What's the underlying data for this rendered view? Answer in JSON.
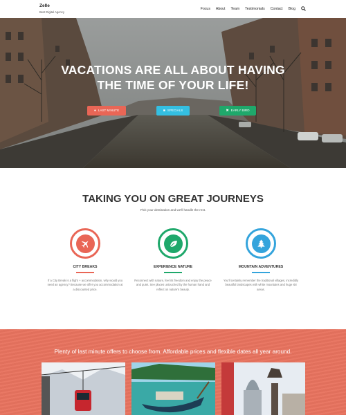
{
  "header": {
    "brand": "Zelle",
    "tagline": "Best Digital Agency",
    "nav": [
      "Focus",
      "About",
      "Team",
      "Testimonials",
      "Contact",
      "Blog"
    ],
    "search_icon": "search-icon"
  },
  "hero": {
    "title_line1": "VACATIONS ARE ALL ABOUT HAVING",
    "title_line2": "THE TIME OF YOUR LIFE!",
    "buttons": [
      {
        "label": "LAST MINUTE",
        "icon": "tag-icon",
        "color": "#e96656"
      },
      {
        "label": "SPECIALS",
        "icon": "gift-icon",
        "color": "#34bfe2"
      },
      {
        "label": "EARLY BIRD",
        "icon": "plane-icon",
        "color": "#1fa86b"
      }
    ]
  },
  "journeys": {
    "title": "TAKING YOU ON GREAT JOURNEYS",
    "subtitle": "Pick your destination and we'll handle the rest.",
    "features": [
      {
        "title": "CITY BREAKS",
        "icon": "plane-icon",
        "color": "#e96656",
        "desc": "If a City Break is a flight + accommodation, why would you need an agency? Because we offer you accommodation at a discounted price."
      },
      {
        "title": "EXPERIENCE NATURE",
        "icon": "leaf-icon",
        "color": "#1fa86b",
        "desc": "Reconnect with nature, feel its freedom and enjoy the peace and quiet. See places untouched by the human hand and reflect on nature's beauty."
      },
      {
        "title": "MOUNTAIN ADVENTURES",
        "icon": "tree-icon",
        "color": "#34a4dc",
        "desc": "You'll certainly remember the traditional villages, incredibly beautiful landscapes with white mountains and huge ski areas."
      }
    ]
  },
  "offers": {
    "text": "Plenty of last minute offers to choose from. Affordable prices and flexible dates all year around.",
    "background": "#e8735f"
  }
}
